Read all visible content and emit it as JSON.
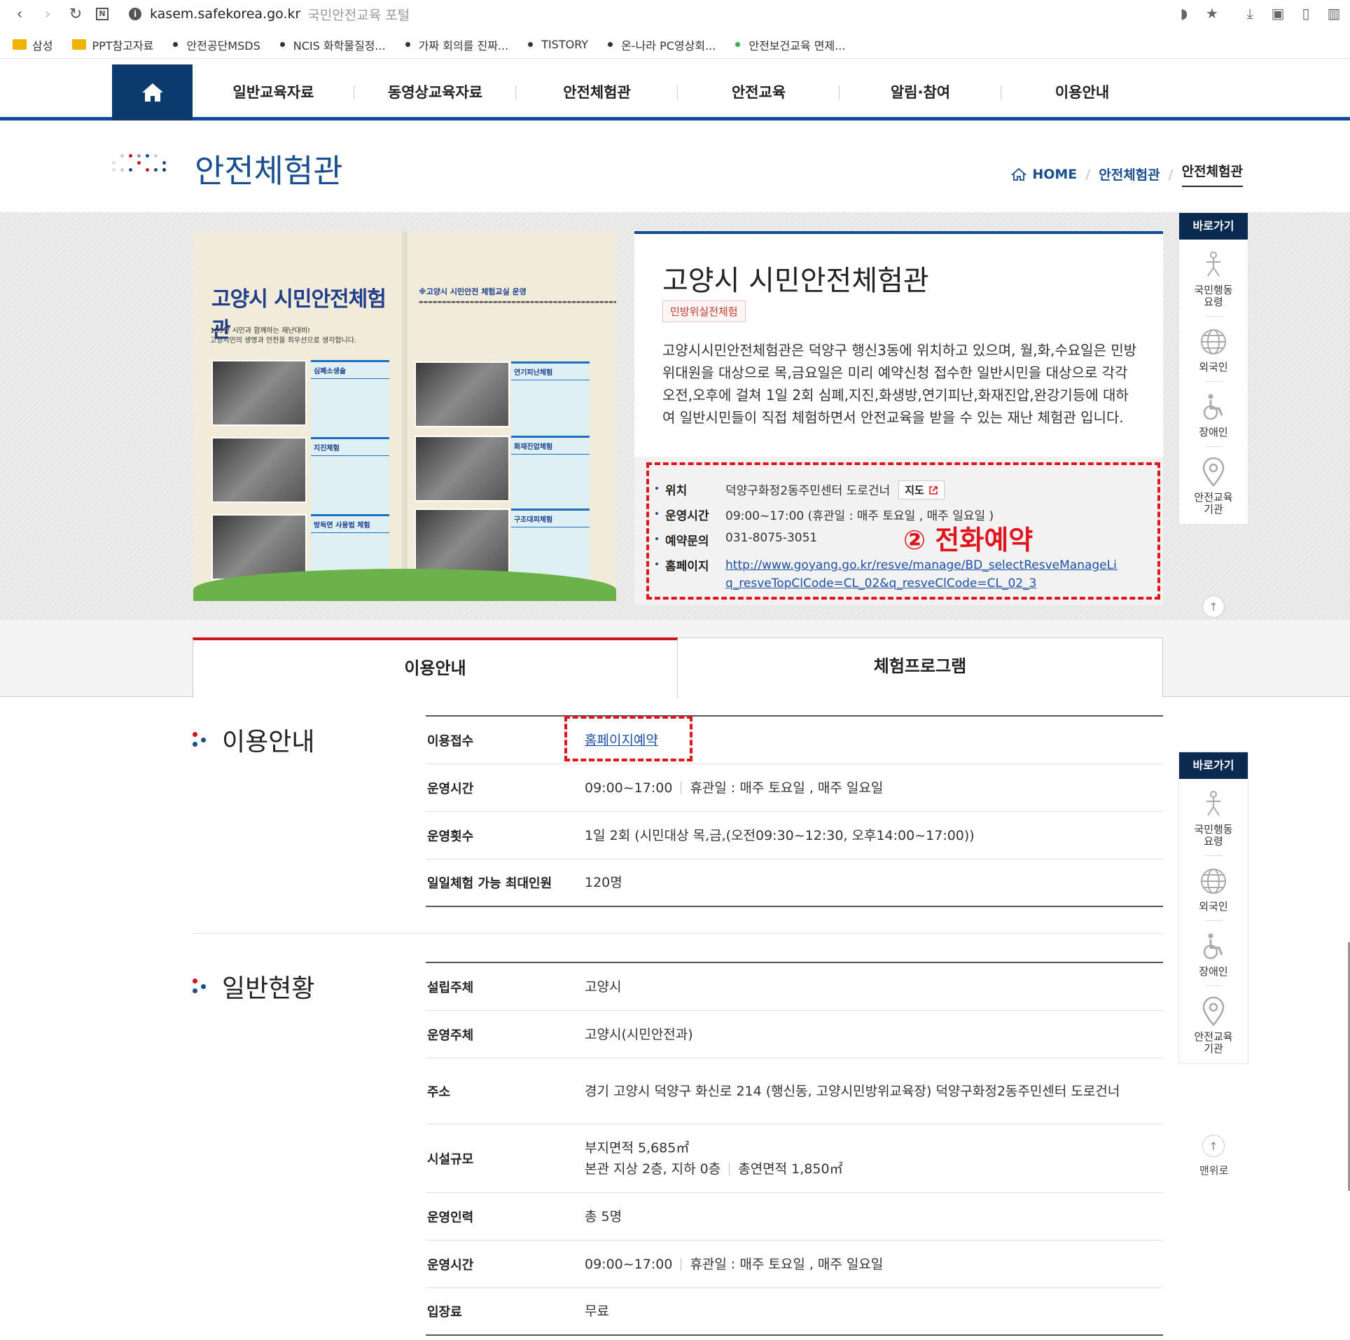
{
  "browser": {
    "url_host": "kasem.safekorea.go.kr",
    "page_title": "국민안전교육 포털",
    "bookmarks": [
      {
        "label": "삼성",
        "type": "folder"
      },
      {
        "label": "PPT참고자료",
        "type": "folder"
      },
      {
        "label": "안전공단MSDS",
        "type": "dot"
      },
      {
        "label": "NCIS 화학물질정...",
        "type": "dot"
      },
      {
        "label": "가짜 회의를 진짜...",
        "type": "dot"
      },
      {
        "label": "TISTORY",
        "type": "dot"
      },
      {
        "label": "온-나라 PC영상회...",
        "type": "dot"
      },
      {
        "label": "안전보건교육 면제...",
        "type": "dot-green"
      }
    ]
  },
  "gnb": {
    "items": [
      "일반교육자료",
      "동영상교육자료",
      "안전체험관",
      "안전교육",
      "알림·참여",
      "이용안내"
    ]
  },
  "page": {
    "title": "안전체험관",
    "breadcrumb": {
      "home": "HOME",
      "level1": "안전체험관",
      "level2": "안전체험관"
    }
  },
  "brochure": {
    "title": "고양시 시민안전체험관",
    "subtitle": "105만 시민과 함께하는 재난대비!\n고양시민의 생명과 안전을 최우선으로 생각합니다.",
    "right_title": "※고양시 시민안전 체험교실 운영",
    "items": [
      "심폐소생술",
      "지진체험",
      "방독면 사용법 체험",
      "연기피난체험",
      "화재진압체험",
      "구조대피체험"
    ]
  },
  "facility": {
    "name": "고양시 시민안전체험관",
    "badge": "민방위실전체험",
    "description": "고양시시민안전체험관은 덕양구 행신3동에 위치하고 있으며, 월,화,수요일은 민방위대원을 대상으로 목,금요일은 미리 예약신청 접수한 일반시민을 대상으로 각각 오전,오후에 걸쳐 1일 2회 심폐,지진,화생방,연기피난,화재진압,완강기등에 대하여 일반시민들이 직접 체험하면서 안전교육을 받을 수 있는 재난 체험관 입니다.",
    "info": {
      "location_label": "위치",
      "location": "덕양구화정2동주민센터 도로건너",
      "map_button": "지도",
      "hours_label": "운영시간",
      "hours": "09:00~17:00 (휴관일 : 매주 토요일 , 매주 일요일 )",
      "contact_label": "예약문의",
      "contact": "031-8075-3051",
      "homepage_label": "홈페이지",
      "homepage_line1": "http://www.goyang.go.kr/resve/manage/BD_selectResveManageList.d",
      "homepage_line2": "q_resveTopClCode=CL_02&q_resveClCode=CL_02_3"
    },
    "annotation": "② 전화예약"
  },
  "quick": {
    "header": "바로가기",
    "items": [
      {
        "label": "국민행동\n요령",
        "icon": "person-icon"
      },
      {
        "label": "외국인",
        "icon": "globe-icon"
      },
      {
        "label": "장애인",
        "icon": "wheelchair-icon"
      },
      {
        "label": "안전교육\n기관",
        "icon": "location-pin-icon"
      }
    ],
    "top_label": "맨위로"
  },
  "tabs": {
    "active": "이용안내",
    "inactive": "체험프로그램"
  },
  "usage": {
    "heading": "이용안내",
    "rows": [
      {
        "k": "이용접수",
        "v": "홈페이지예약"
      },
      {
        "k": "운영시간",
        "v1": "09:00~17:00",
        "v2": "휴관일 : 매주 토요일 , 매주 일요일"
      },
      {
        "k": "운영횟수",
        "v": "1일 2회 (시민대상 목,금,(오전09:30~12:30, 오후14:00~17:00))"
      },
      {
        "k": "일일체험 가능 최대인원",
        "v": "120명"
      }
    ]
  },
  "status": {
    "heading": "일반현황",
    "rows": [
      {
        "k": "설립주체",
        "v": "고양시"
      },
      {
        "k": "운영주체",
        "v": "고양시(시민안전과)"
      },
      {
        "k": "주소",
        "v": "경기 고양시 덕양구 화신로 214 (행신동, 고양시민방위교육장) 덕양구화정2동주민센터 도로건너"
      },
      {
        "k": "시설규모",
        "v1": "부지면적 5,685㎡",
        "v2a": "본관 지상 2층, 지하 0층",
        "v2b": "총연면적 1,850㎡"
      },
      {
        "k": "운영인력",
        "v": "총 5명"
      },
      {
        "k": "운영시간",
        "v1": "09:00~17:00",
        "v2": "휴관일 : 매주 토요일 , 매주 일요일"
      },
      {
        "k": "입장료",
        "v": "무료"
      }
    ]
  },
  "colors": {
    "primary": "#0d4c96",
    "navy": "#0b3a6e",
    "annotation": "#e0161e",
    "tab_accent": "#c8171e"
  }
}
